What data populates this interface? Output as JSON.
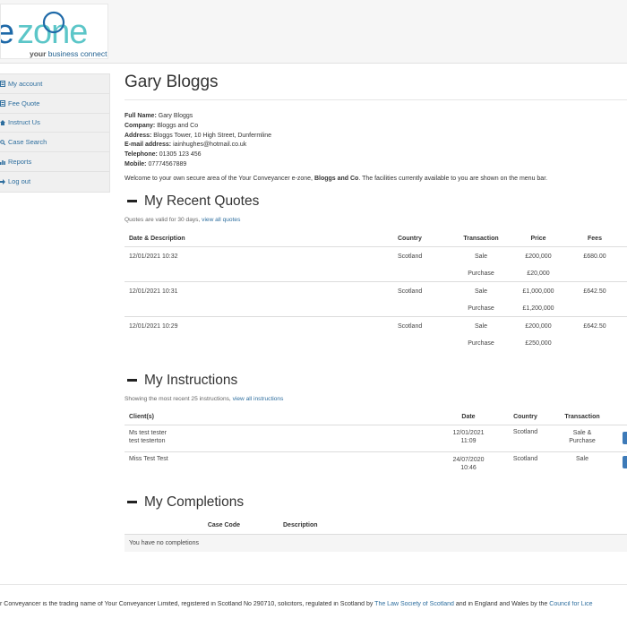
{
  "brand": {
    "logo_text": "ezone",
    "tagline_bold": "your",
    "tagline_rest": " business connection",
    "accent": "#5cc6c8",
    "ring_color": "#1e69a8"
  },
  "sidebar": {
    "items": [
      {
        "label": "My account",
        "icon": "document-icon"
      },
      {
        "label": "Fee Quote",
        "icon": "document-icon"
      },
      {
        "label": "Instruct Us",
        "icon": "home-icon"
      },
      {
        "label": "Case Search",
        "icon": "search-icon"
      },
      {
        "label": "Reports",
        "icon": "chart-icon"
      },
      {
        "label": "Log out",
        "icon": "arrow-icon"
      }
    ]
  },
  "page": {
    "title": "Gary Bloggs"
  },
  "profile": {
    "full_name_label": "Full Name:",
    "full_name": "Gary Bloggs",
    "company_label": "Company:",
    "company": "Bloggs and Co",
    "address_label": "Address:",
    "address": "Bloggs Tower, 10 High Street, Dunfermline",
    "email_label": "E-mail address:",
    "email": "iainhughes@hotmail.co.uk",
    "telephone_label": "Telephone:",
    "telephone": "01305 123 456",
    "mobile_label": "Mobile:",
    "mobile": "07774567889"
  },
  "welcome": {
    "prefix": "Welcome to your own secure area of the Your Conveyancer e-zone, ",
    "company": "Bloggs and Co",
    "suffix": ". The facilities currently available to you are shown on the menu bar."
  },
  "quotes": {
    "title": "My Recent Quotes",
    "note_prefix": "Quotes are valid for 30 days, ",
    "note_link": "view all quotes",
    "headers": {
      "date": "Date & Description",
      "country": "Country",
      "transaction": "Transaction",
      "price": "Price",
      "fees": "Fees"
    },
    "rows": [
      {
        "date": "12/01/2021 10:32",
        "country": "Scotland",
        "t1": "Sale",
        "p1": "£200,000",
        "fees": "£680.00",
        "t2": "Purchase",
        "p2": "£20,000"
      },
      {
        "date": "12/01/2021 10:31",
        "country": "Scotland",
        "t1": "Sale",
        "p1": "£1,000,000",
        "fees": "£642.50",
        "t2": "Purchase",
        "p2": "£1,200,000"
      },
      {
        "date": "12/01/2021 10:29",
        "country": "Scotland",
        "t1": "Sale",
        "p1": "£200,000",
        "fees": "£642.50",
        "t2": "Purchase",
        "p2": "£250,000"
      }
    ]
  },
  "instructions": {
    "title": "My Instructions",
    "note_prefix": "Showing the most recent 25 instructions, ",
    "note_link": "view all instructions",
    "headers": {
      "clients": "Client(s)",
      "date": "Date",
      "country": "Country",
      "transaction": "Transaction"
    },
    "rows": [
      {
        "client1": "Ms test tester",
        "client2": "test testerton",
        "date1": "12/01/2021",
        "date2": "11:09",
        "country": "Scotland",
        "t1": "Sale &",
        "t2": "Purchase"
      },
      {
        "client1": "Miss Test Test",
        "client2": "",
        "date1": "24/07/2020",
        "date2": "10:46",
        "country": "Scotland",
        "t1": "Sale",
        "t2": ""
      }
    ]
  },
  "completions": {
    "title": "My Completions",
    "headers": {
      "case_code": "Case Code",
      "description": "Description"
    },
    "empty": "You have no completions"
  },
  "footer": {
    "text1": "r Conveyancer is the trading name of Your Conveyancer Limited, registered in Scotland No 290710, solicitors, regulated in Scotland by ",
    "link1": "The Law Society of Scotland",
    "text2": " and in England and Wales by the ",
    "link2": "Council for Lice"
  }
}
